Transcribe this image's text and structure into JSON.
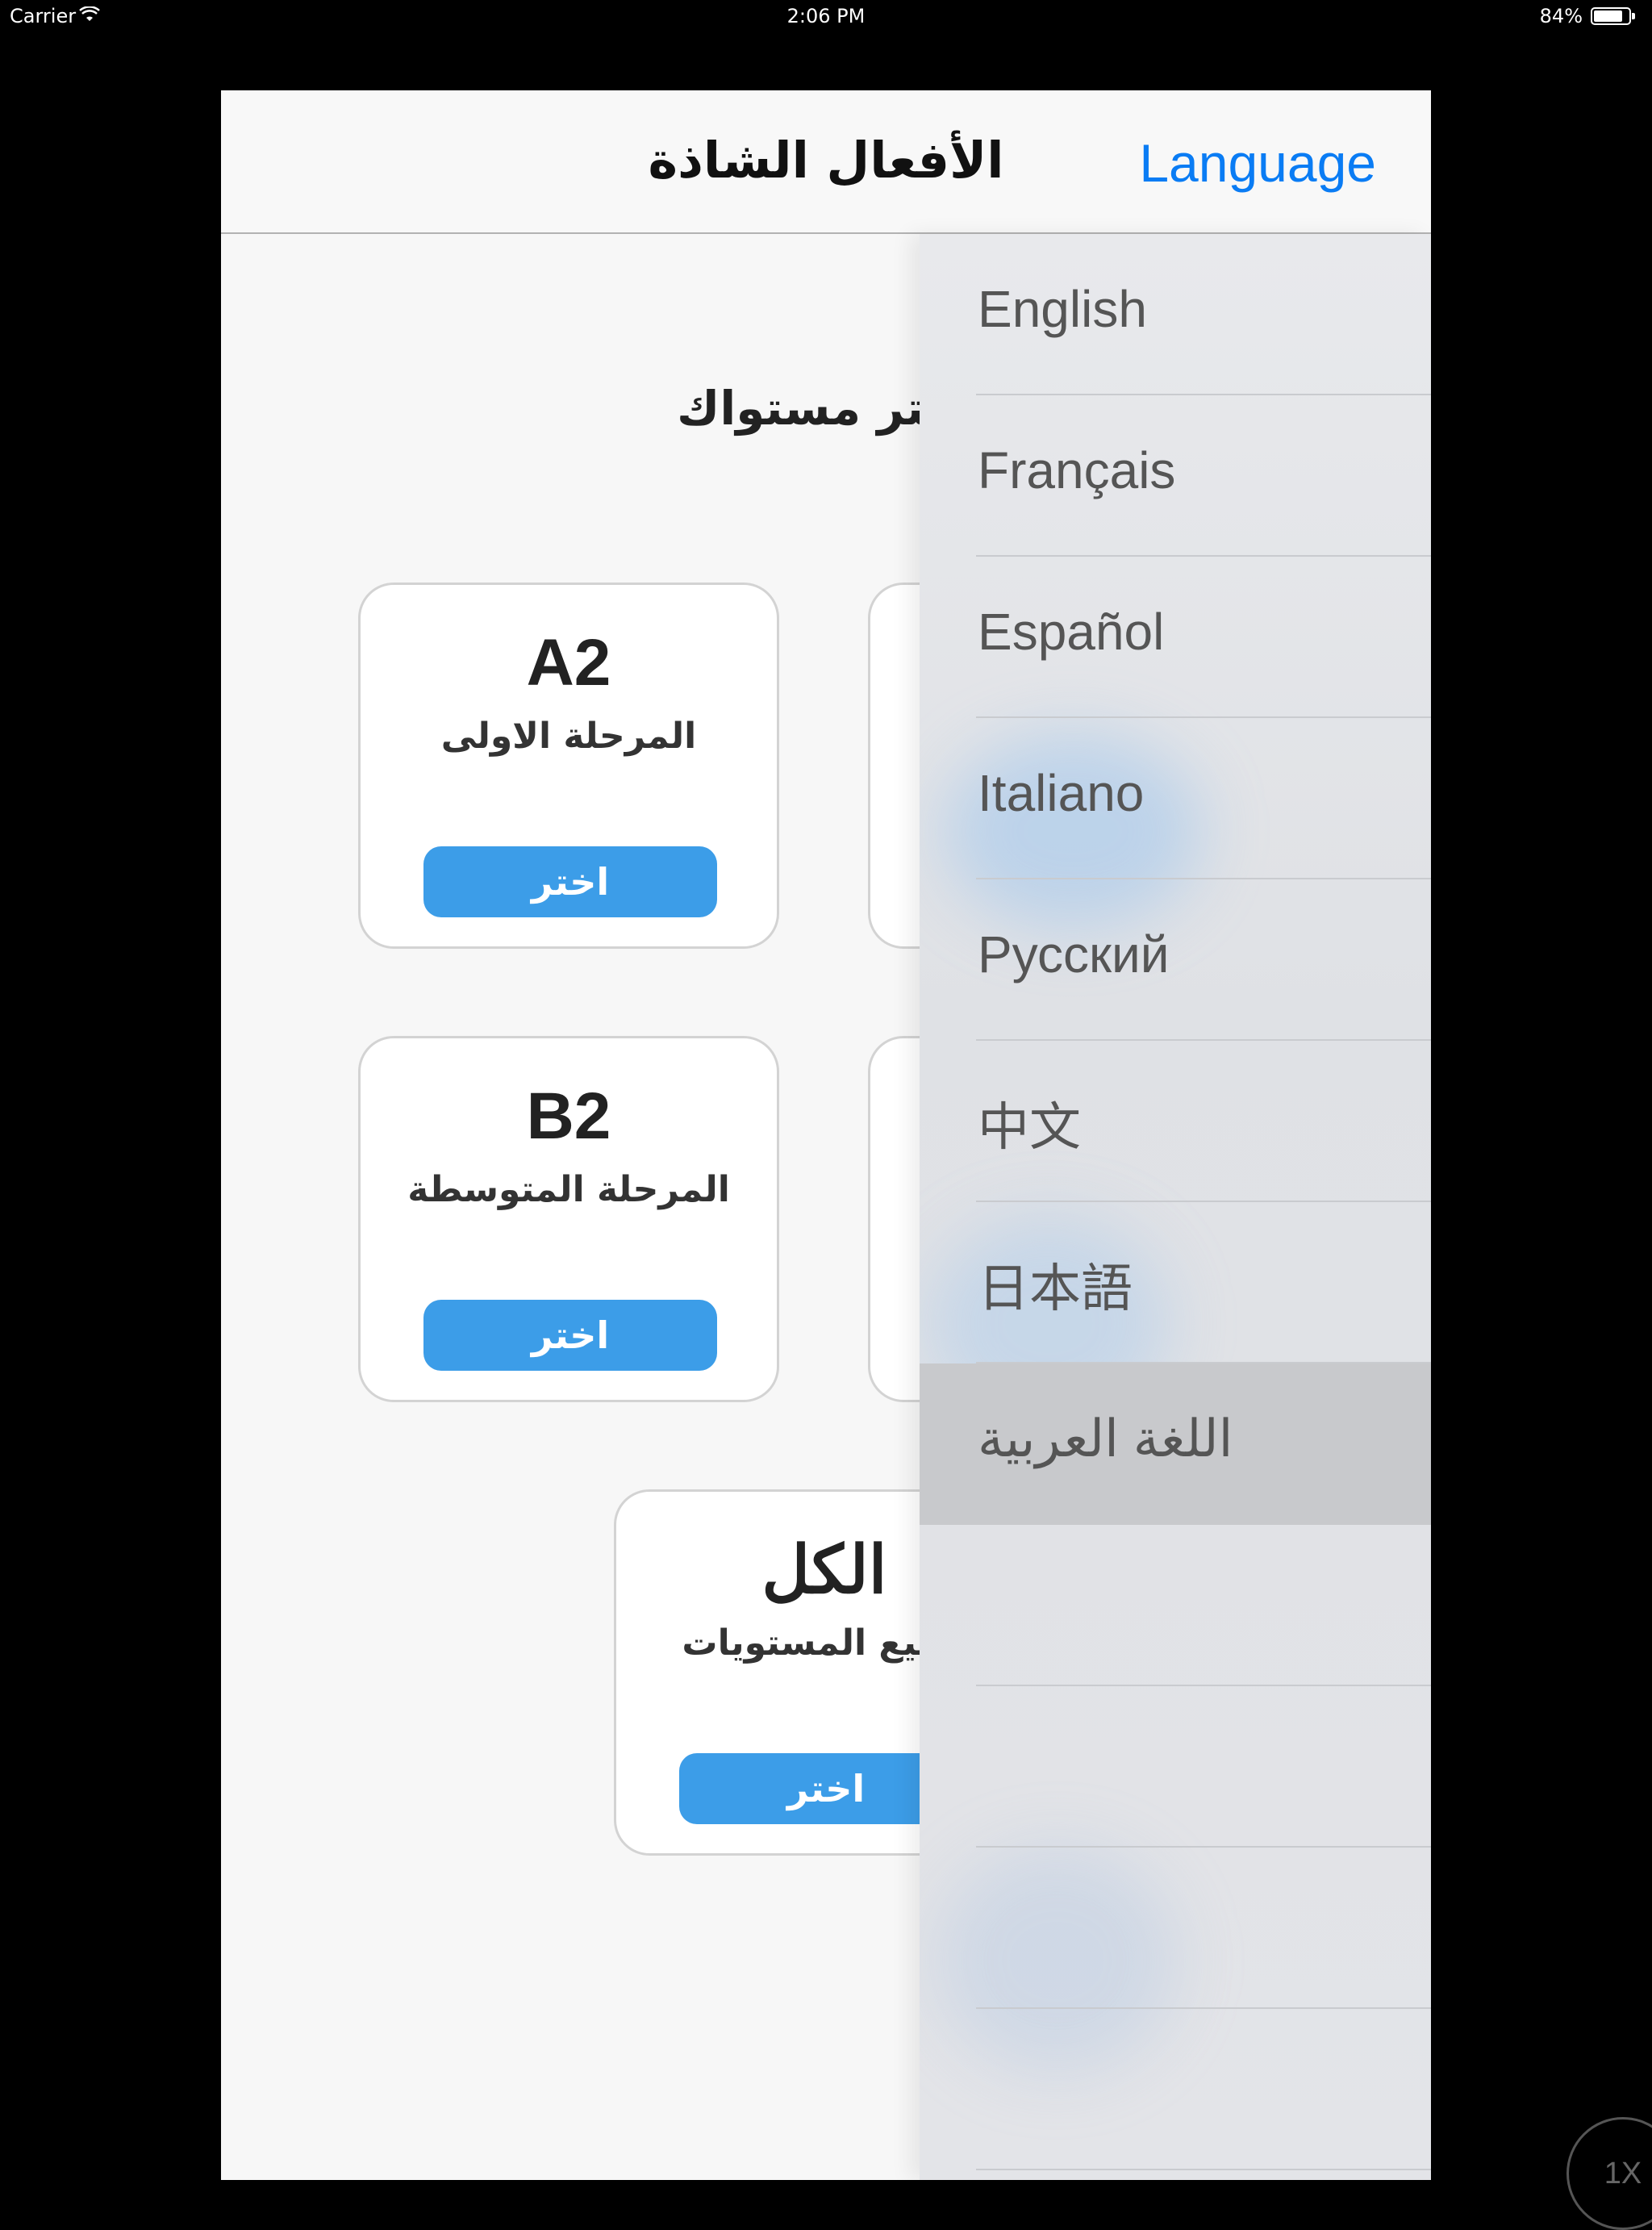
{
  "status_bar": {
    "carrier": "Carrier",
    "wifi_icon": "wifi-icon",
    "time": "2:06 PM",
    "battery_percent": "84%",
    "battery_level": 0.84
  },
  "navbar": {
    "title": "الأفعال الشاذة",
    "language_button": "Language"
  },
  "main": {
    "heading": "اختر مستواك",
    "levels": [
      {
        "code": "A2",
        "name": "المرحلة الاولى",
        "button": "اختر"
      },
      {
        "code": "B2",
        "name": "المرحلة المتوسطة",
        "button": "اختر"
      },
      {
        "code": "الكل",
        "name": "جميع المستويات",
        "button": "اختر"
      }
    ]
  },
  "language_menu": {
    "items": [
      {
        "label": "English"
      },
      {
        "label": "Français"
      },
      {
        "label": "Español"
      },
      {
        "label": "Italiano"
      },
      {
        "label": "Русский"
      },
      {
        "label": "中文"
      },
      {
        "label": "日本語"
      },
      {
        "label": "اللغة العربية",
        "selected": true
      },
      {
        "label": ""
      },
      {
        "label": ""
      },
      {
        "label": ""
      },
      {
        "label": ""
      }
    ]
  },
  "zoom_badge": "1X",
  "colors": {
    "accent": "#0a7cf4",
    "button": "#3c9de8",
    "selected_row": "#c8c9cc"
  }
}
